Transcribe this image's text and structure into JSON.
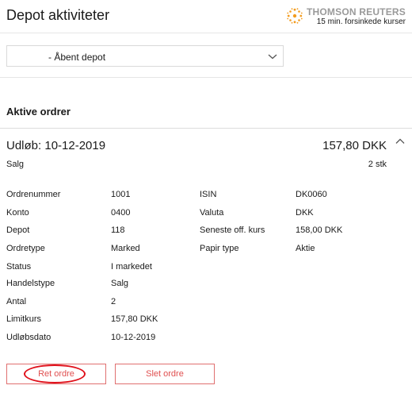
{
  "header": {
    "title": "Depot aktiviteter",
    "provider": {
      "brand": "THOMSON REUTERS",
      "note": "15 min. forsinkede kurser",
      "logo_color": "#f39c1f"
    }
  },
  "depot_select": {
    "value": "- Åbent depot",
    "icon": "chevron-down-icon"
  },
  "section": {
    "title": "Aktive ordrer"
  },
  "order": {
    "expiry_text": "Udløb: 10-12-2019",
    "amount": "157,80 DKK",
    "side": "Salg",
    "quantity": "2 stk",
    "collapse_icon": "chevron-up-icon",
    "details_left": [
      {
        "label": "Ordrenummer",
        "value": "1001"
      },
      {
        "label": "Konto",
        "value": "0400"
      },
      {
        "label": "Depot",
        "value": "118"
      },
      {
        "label": "Ordretype",
        "value": "Marked"
      },
      {
        "label": "Status",
        "value": "I markedet"
      },
      {
        "label": "Handelstype",
        "value": "Salg"
      },
      {
        "label": "Antal",
        "value": "2"
      },
      {
        "label": "Limitkurs",
        "value": "157,80 DKK"
      },
      {
        "label": "Udløbsdato",
        "value": "10-12-2019"
      }
    ],
    "details_right": [
      {
        "label": "ISIN",
        "value": "DK0060"
      },
      {
        "label": "Valuta",
        "value": "DKK"
      },
      {
        "label": "Seneste off. kurs",
        "value": "158,00 DKK"
      },
      {
        "label": "Papir type",
        "value": "Aktie"
      }
    ]
  },
  "actions": {
    "edit_label": "Ret ordre",
    "delete_label": "Slet ordre",
    "accent_color": "#e05050",
    "highlight_color": "#e0101a"
  }
}
